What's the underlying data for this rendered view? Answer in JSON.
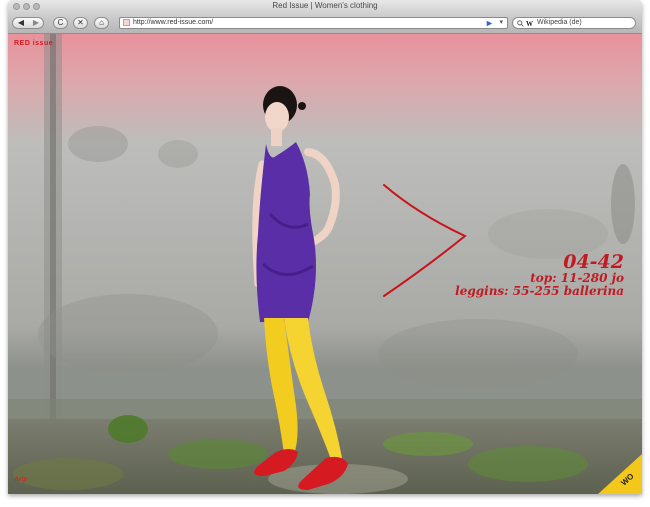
{
  "window": {
    "title": "Red Issue | Women's clothing"
  },
  "toolbar": {
    "back_glyph": "◀",
    "forward_glyph": "▶",
    "reload_glyph": "C",
    "stop_glyph": "✕",
    "home_glyph": "⌂",
    "url": "http://www.red-issue.com/",
    "search_value": "Wikipedia (de)",
    "search_engine_label": "W"
  },
  "page": {
    "logo_text": "RED issue",
    "help_text": "help",
    "product_code": "04-42",
    "top_line": "top: 11-280 jo",
    "leggings_line": "leggins: 55-255 ballerina",
    "badge_text": "WO"
  },
  "colors": {
    "brand_red": "#d51a22",
    "sky_pink": "#e89aa2",
    "wall_grey": "#b7b7b4",
    "dress_purple": "#5a2ea6",
    "leggings_yellow": "#f2cc1e",
    "badge_yellow": "#f4c81b"
  },
  "icons": {
    "back": "back-arrow-icon",
    "forward": "forward-arrow-icon",
    "reload": "reload-icon",
    "stop": "stop-icon",
    "home": "home-icon",
    "rss": "rss-icon",
    "search": "search-icon"
  }
}
